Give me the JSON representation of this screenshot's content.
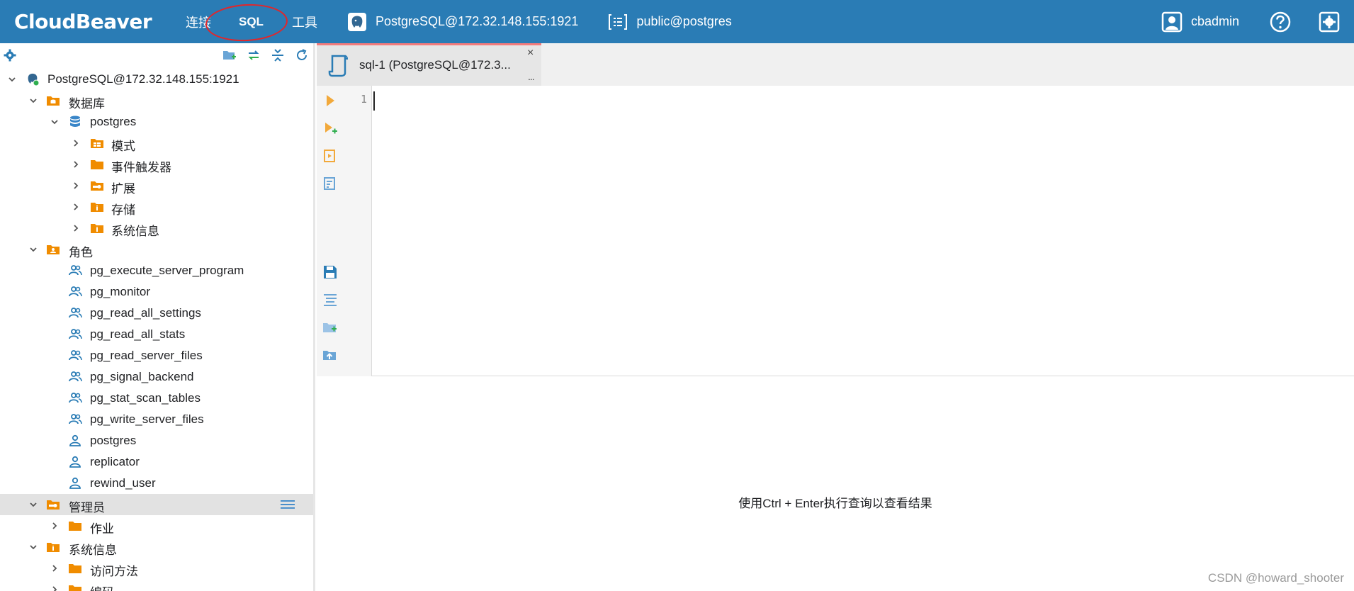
{
  "topbar": {
    "logo_text": "CloudBeaver",
    "menu": {
      "connect": "连接",
      "sql": "SQL",
      "tools": "工具"
    },
    "connection": "PostgreSQL@172.32.148.155:1921",
    "schema": "public@postgres",
    "user": "cbadmin"
  },
  "navigator": {
    "root": "PostgreSQL@172.32.148.155:1921",
    "items": [
      {
        "label": "数据库"
      },
      {
        "label": "postgres"
      },
      {
        "label": "模式"
      },
      {
        "label": "事件触发器"
      },
      {
        "label": "扩展"
      },
      {
        "label": "存储"
      },
      {
        "label": "系统信息"
      },
      {
        "label": "角色"
      },
      {
        "label": "pg_execute_server_program"
      },
      {
        "label": "pg_monitor"
      },
      {
        "label": "pg_read_all_settings"
      },
      {
        "label": "pg_read_all_stats"
      },
      {
        "label": "pg_read_server_files"
      },
      {
        "label": "pg_signal_backend"
      },
      {
        "label": "pg_stat_scan_tables"
      },
      {
        "label": "pg_write_server_files"
      },
      {
        "label": "postgres"
      },
      {
        "label": "replicator"
      },
      {
        "label": "rewind_user"
      },
      {
        "label": "管理员"
      },
      {
        "label": "作业"
      },
      {
        "label": "系统信息"
      },
      {
        "label": "访问方法"
      },
      {
        "label": "编码"
      }
    ]
  },
  "editor": {
    "tab_title": "sql-1 (PostgreSQL@172.3...",
    "tab_close": "×",
    "tab_more": "...",
    "line_number": "1"
  },
  "results": {
    "hint": "使用Ctrl + Enter执行查询以查看结果"
  },
  "watermark": "CSDN @howard_shooter",
  "colors": {
    "topbar": "#2a7cb5",
    "folder": "#f08c00",
    "accent_blue": "#3a86c8",
    "annotation_circle": "#e2262a"
  }
}
